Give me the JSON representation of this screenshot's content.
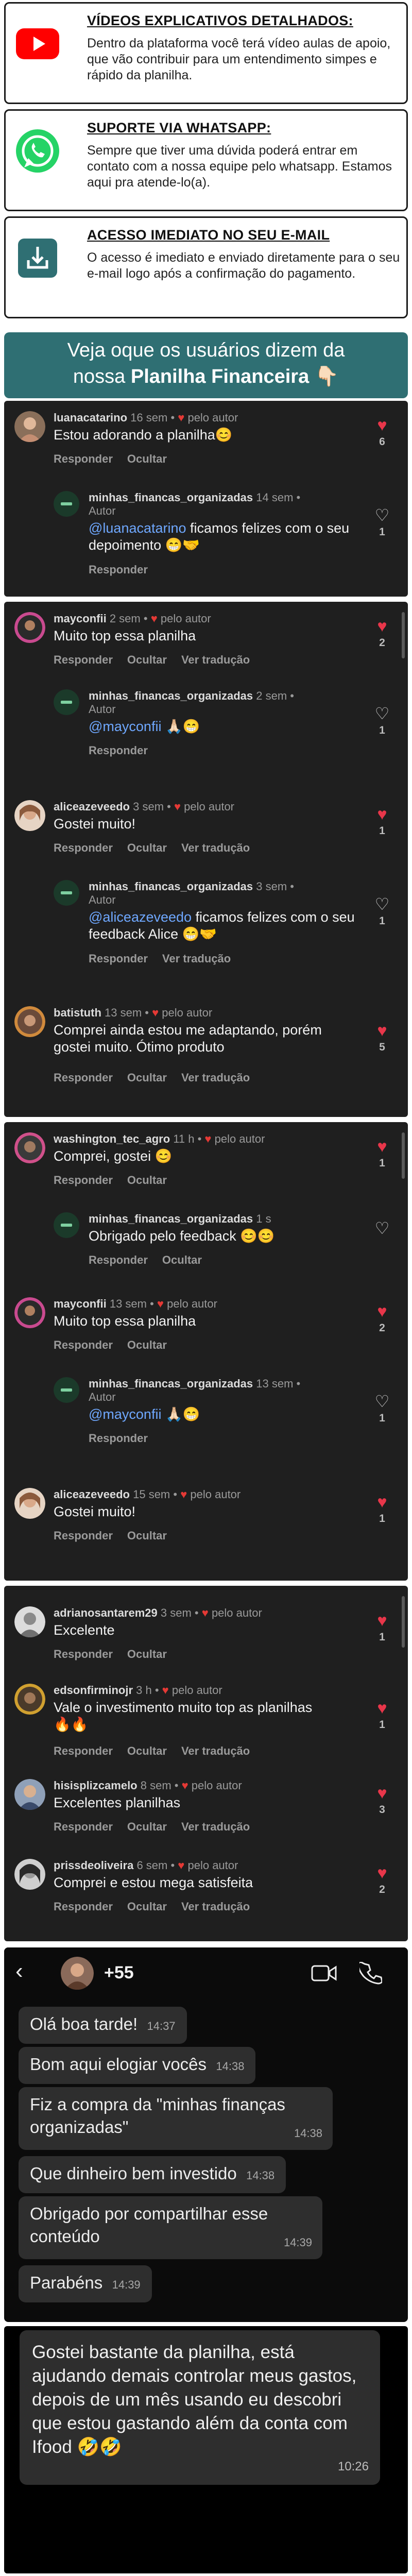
{
  "features": [
    {
      "title": "VÍDEOS EXPLICATIVOS DETALHADOS:",
      "text": "Dentro da plataforma você terá vídeo aulas de apoio, que vão contribuir para um entendimento simpes e rápido da planilha.",
      "icon": "youtube-icon"
    },
    {
      "title": "SUPORTE VIA WHATSAPP:",
      "text": "Sempre que tiver uma dúvida poderá entrar em contato com a nossa equipe pelo whatsapp. Estamos aqui pra atende-lo(a).",
      "icon": "whatsapp-icon"
    },
    {
      "title": "ACESSO IMEDIATO NO SEU E-MAIL",
      "text": "O acesso é imediato e enviado diretamente para o seu e-mail logo após a confirmação do pagamento.",
      "icon": "download-icon"
    }
  ],
  "banner": {
    "line1": "Veja oque os usuários dizem da",
    "line2_prefix": "nossa ",
    "line2_bold": "Planilha Financeira",
    "emoji": "👇🏻"
  },
  "labels": {
    "reply": "Responder",
    "hide": "Ocultar",
    "translate": "Ver tradução",
    "author": "Autor",
    "by_author": "pelo autor"
  },
  "panels": [
    {
      "comments": [
        {
          "user": "luanacatarino",
          "time": "16 sem",
          "author_like": true,
          "text": "Estou adorando a planilha😊",
          "likes": "6",
          "liked": true,
          "reply": false,
          "hide": false,
          "translate": false
        },
        {
          "user": "minhas_financas_organizadas",
          "time": "14 sem",
          "author": true,
          "mention": "@luanacatarino",
          "text": " ficamos felizes com o seu depoimento 😁🤝",
          "likes": "1",
          "liked": false,
          "reply": true
        }
      ]
    },
    {
      "comments": [
        {
          "user": "mayconfii",
          "time": "2 sem",
          "author_like": true,
          "text": "Muito top essa planilha",
          "likes": "2",
          "liked": true
        },
        {
          "user": "minhas_financas_organizadas",
          "time": "2 sem",
          "author": true,
          "mention": "@mayconfii",
          "text": " 🙏🏻😁",
          "likes": "1",
          "liked": false
        },
        {
          "user": "aliceazeveedo",
          "time": "3 sem",
          "author_like": true,
          "text": "Gostei muito!",
          "likes": "1",
          "liked": true
        },
        {
          "user": "minhas_financas_organizadas",
          "time": "3 sem",
          "author": true,
          "mention": "@aliceazeveedo",
          "text": " ficamos felizes com o seu feedback Alice 😁🤝",
          "likes": "1",
          "liked": false
        },
        {
          "user": "batistuth",
          "time": "13 sem",
          "author_like": true,
          "text": "Comprei ainda estou me adaptando, porém gostei muito. Ótimo produto",
          "likes": "5",
          "liked": true
        }
      ]
    },
    {
      "comments": [
        {
          "user": "washington_tec_agro",
          "time": "11 h",
          "author_like": true,
          "text": "Comprei, gostei 😊",
          "likes": "1",
          "liked": true
        },
        {
          "user": "minhas_financas_organizadas",
          "time": "1 s",
          "author": false,
          "text": "Obrigado pelo feedback 😊😊",
          "likes": "",
          "liked": false
        },
        {
          "user": "mayconfii",
          "time": "13 sem",
          "author_like": true,
          "text": "Muito top essa planilha",
          "likes": "2",
          "liked": true
        },
        {
          "user": "minhas_financas_organizadas",
          "time": "13 sem",
          "author": true,
          "mention": "@mayconfii",
          "text": " 🙏🏻😁",
          "likes": "1",
          "liked": false
        },
        {
          "user": "aliceazeveedo",
          "time": "15 sem",
          "author_like": true,
          "text": "Gostei muito!",
          "likes": "1",
          "liked": true
        }
      ]
    },
    {
      "comments": [
        {
          "user": "adrianosantarem29",
          "time": "3 sem",
          "author_like": true,
          "text": "Excelente",
          "likes": "1",
          "liked": true
        },
        {
          "user": "edsonfirminojr",
          "time": "3 h",
          "author_like": true,
          "text": "Vale o investimento muito top as planilhas 🔥🔥",
          "likes": "1",
          "liked": true
        },
        {
          "user": "hisisplizcamelo",
          "time": "8 sem",
          "author_like": true,
          "text": "Excelentes planilhas",
          "likes": "3",
          "liked": true
        },
        {
          "user": "prissdeoliveira",
          "time": "6 sem",
          "author_like": true,
          "text": "Comprei e estou mega satisfeita",
          "likes": "2",
          "liked": true
        }
      ]
    }
  ],
  "whatsapp": {
    "contact": "+55",
    "messages": [
      {
        "text": "Olá boa tarde!",
        "time": "14:37"
      },
      {
        "text": "Bom aqui elogiar vocês",
        "time": "14:38"
      },
      {
        "text": "Fiz a compra da \"minhas finanças organizadas\"",
        "time": "14:38"
      },
      {
        "text": "Que dinheiro bem investido",
        "time": "14:38"
      },
      {
        "text": "Obrigado por compartilhar esse conteúdo",
        "time": "14:39"
      },
      {
        "text": "Parabéns",
        "time": "14:39"
      }
    ]
  },
  "final_message": {
    "text": "Gostei bastante da planilha, está ajudando demais controlar meus gastos, depois de um mês usando eu descobri que estou gastando além da conta com Ifood 🤣🤣",
    "time": "10:26"
  },
  "colors": {
    "banner": "#2f6f73",
    "panel": "#1f1f1f",
    "heart": "#e8364a",
    "youtube": "#ff0000",
    "whatsapp": "#25d366",
    "download": "#2f6f73"
  }
}
